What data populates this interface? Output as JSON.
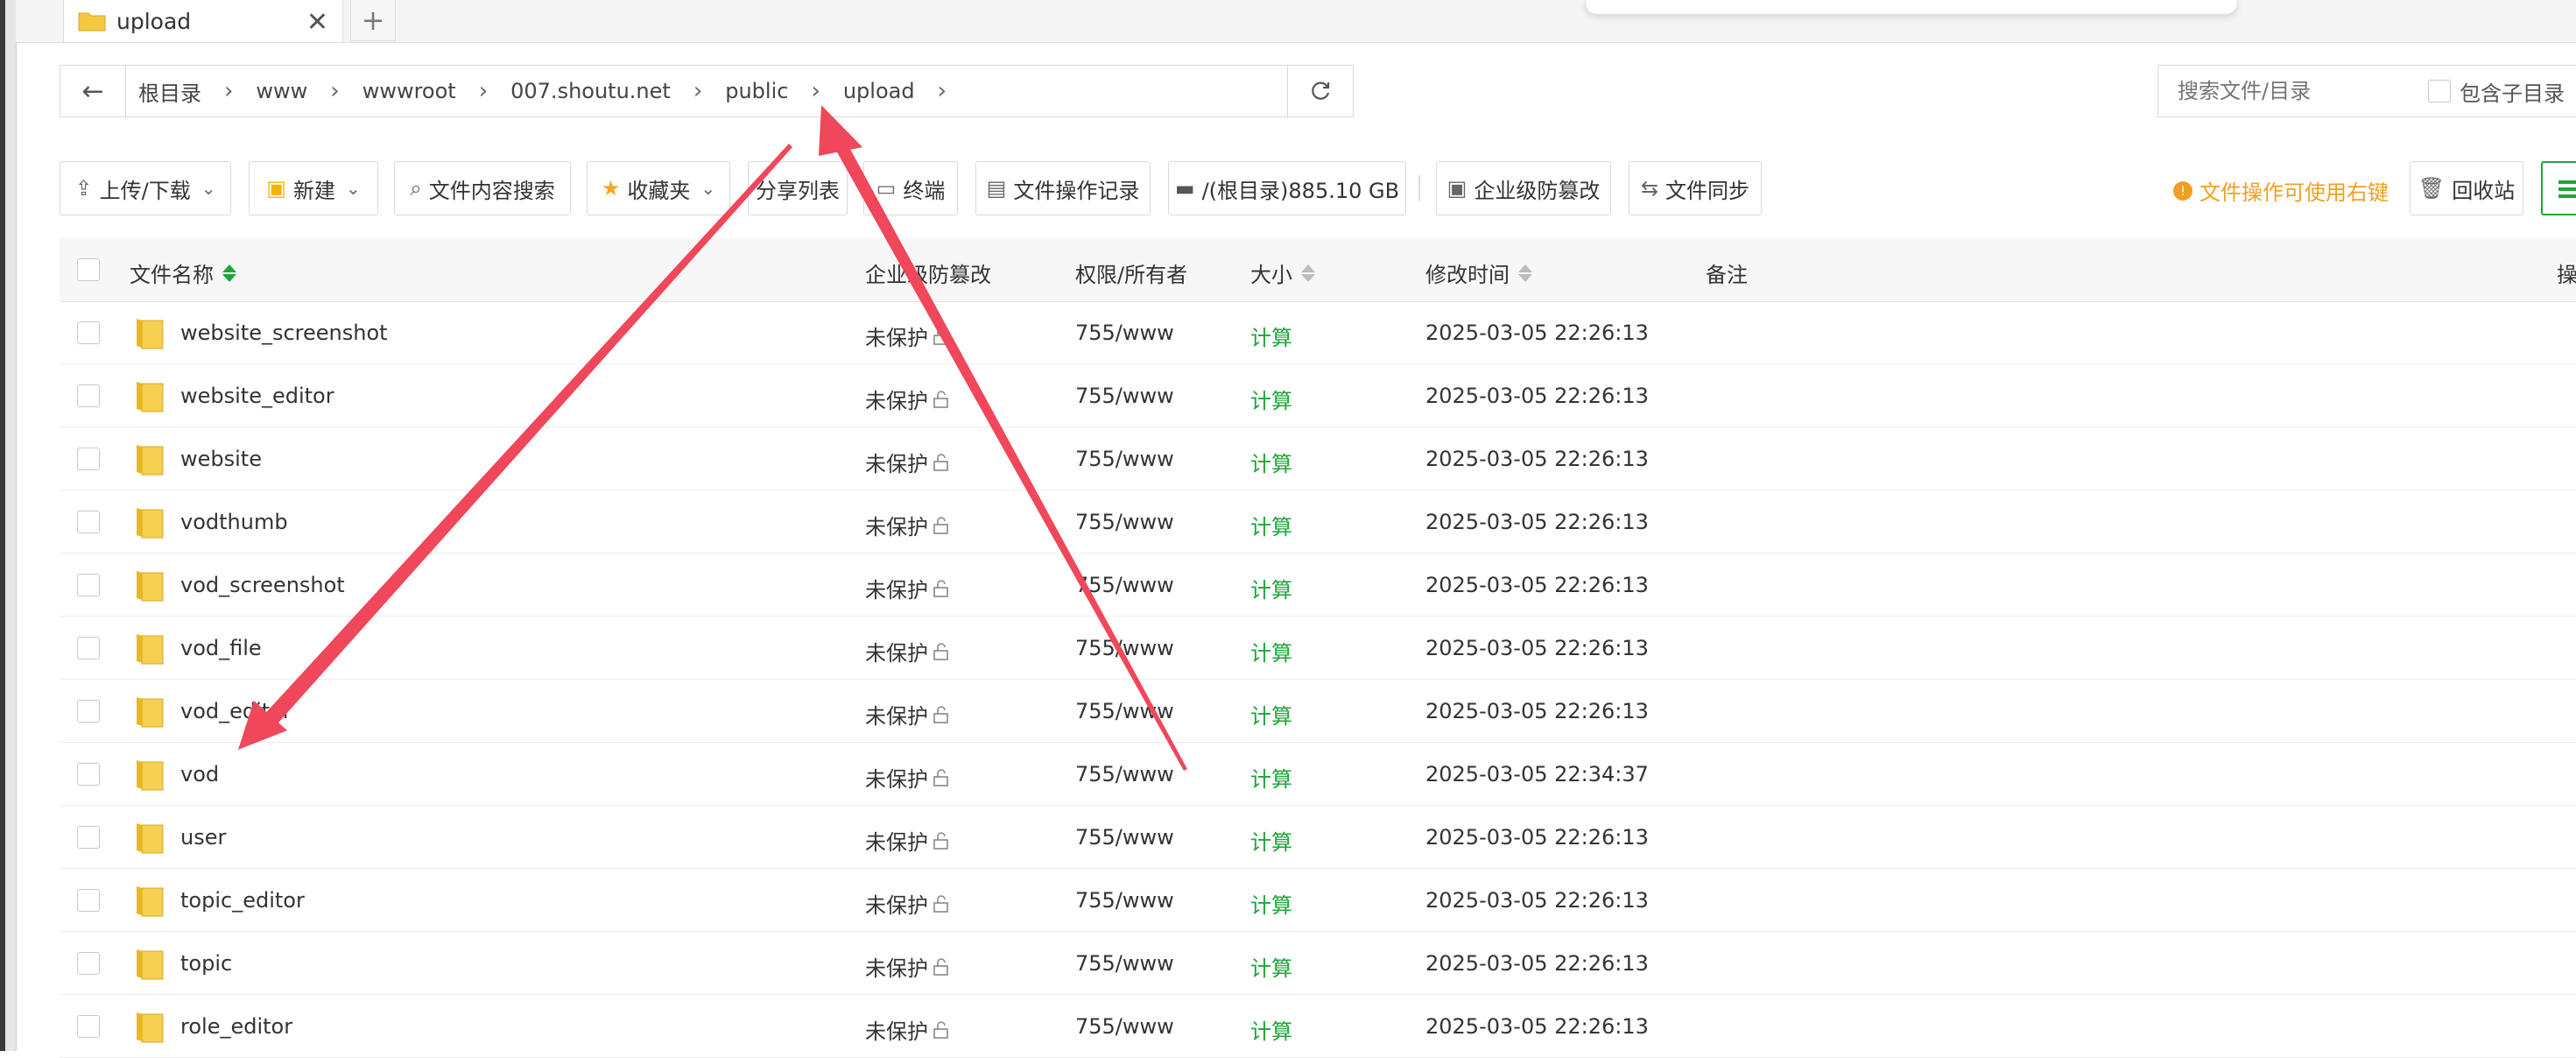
{
  "tab": {
    "label": "upload",
    "add_label": "+",
    "close_label": "✕"
  },
  "breadcrumb": [
    "根目录",
    "www",
    "wwwroot",
    "007.shoutu.net",
    "public",
    "upload"
  ],
  "search": {
    "placeholder": "搜索文件/目录",
    "subdir_label": "包含子目录"
  },
  "toolbar": {
    "upload_label": "上传/下载",
    "new_label": "新建",
    "content_search_label": "文件内容搜索",
    "favorites_label": "收藏夹",
    "share_list_label": "分享列表",
    "terminal_label": "终端",
    "log_label": "文件操作记录",
    "disk_label": "/(根目录)885.10 GB",
    "tamper_label": "企业级防篡改",
    "sync_label": "文件同步",
    "tip_label": "文件操作可使用右键",
    "recycle_label": "回收站"
  },
  "table": {
    "columns": {
      "name": "文件名称",
      "protect": "企业级防篡改",
      "perm": "权限/所有者",
      "size": "大小",
      "mtime": "修改时间",
      "note": "备注",
      "ops": "操"
    },
    "rows": [
      {
        "name": "website_screenshot",
        "protect": "未保护",
        "perm": "755/www",
        "size": "计算",
        "mtime": "2025-03-05 22:26:13"
      },
      {
        "name": "website_editor",
        "protect": "未保护",
        "perm": "755/www",
        "size": "计算",
        "mtime": "2025-03-05 22:26:13"
      },
      {
        "name": "website",
        "protect": "未保护",
        "perm": "755/www",
        "size": "计算",
        "mtime": "2025-03-05 22:26:13"
      },
      {
        "name": "vodthumb",
        "protect": "未保护",
        "perm": "755/www",
        "size": "计算",
        "mtime": "2025-03-05 22:26:13"
      },
      {
        "name": "vod_screenshot",
        "protect": "未保护",
        "perm": "755/www",
        "size": "计算",
        "mtime": "2025-03-05 22:26:13"
      },
      {
        "name": "vod_file",
        "protect": "未保护",
        "perm": "755/www",
        "size": "计算",
        "mtime": "2025-03-05 22:26:13"
      },
      {
        "name": "vod_editor",
        "protect": "未保护",
        "perm": "755/www",
        "size": "计算",
        "mtime": "2025-03-05 22:26:13"
      },
      {
        "name": "vod",
        "protect": "未保护",
        "perm": "755/www",
        "size": "计算",
        "mtime": "2025-03-05 22:34:37"
      },
      {
        "name": "user",
        "protect": "未保护",
        "perm": "755/www",
        "size": "计算",
        "mtime": "2025-03-05 22:26:13"
      },
      {
        "name": "topic_editor",
        "protect": "未保护",
        "perm": "755/www",
        "size": "计算",
        "mtime": "2025-03-05 22:26:13"
      },
      {
        "name": "topic",
        "protect": "未保护",
        "perm": "755/www",
        "size": "计算",
        "mtime": "2025-03-05 22:26:13"
      },
      {
        "name": "role_editor",
        "protect": "未保护",
        "perm": "755/www",
        "size": "计算",
        "mtime": "2025-03-05 22:26:13"
      }
    ]
  },
  "colors": {
    "accent": "#20a53a",
    "warning": "#f0a020",
    "annotation": "#f0475a",
    "folder": "#f5c842"
  }
}
